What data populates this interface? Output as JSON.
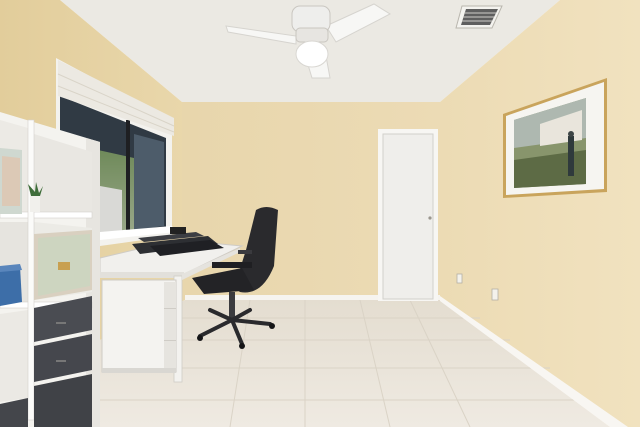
{
  "scene": {
    "colors": {
      "ceiling": "#eceae4",
      "wall_back": "#ead9b1",
      "wall_left": "#e7d4a6",
      "wall_right": "#efdfb9",
      "floor": "#ebe5db",
      "baseboard": "#f7f5f0",
      "door": "#f2f1ee",
      "shelf": "#f4f3ef",
      "drawer_dark": "#4a4c52",
      "desk_top": "#f2f1ee",
      "chair": "#2b2b2e",
      "frame": "#c9a45c"
    },
    "icons": [
      "ceiling-fan-icon",
      "air-vent-icon",
      "power-outlet-icon"
    ]
  }
}
